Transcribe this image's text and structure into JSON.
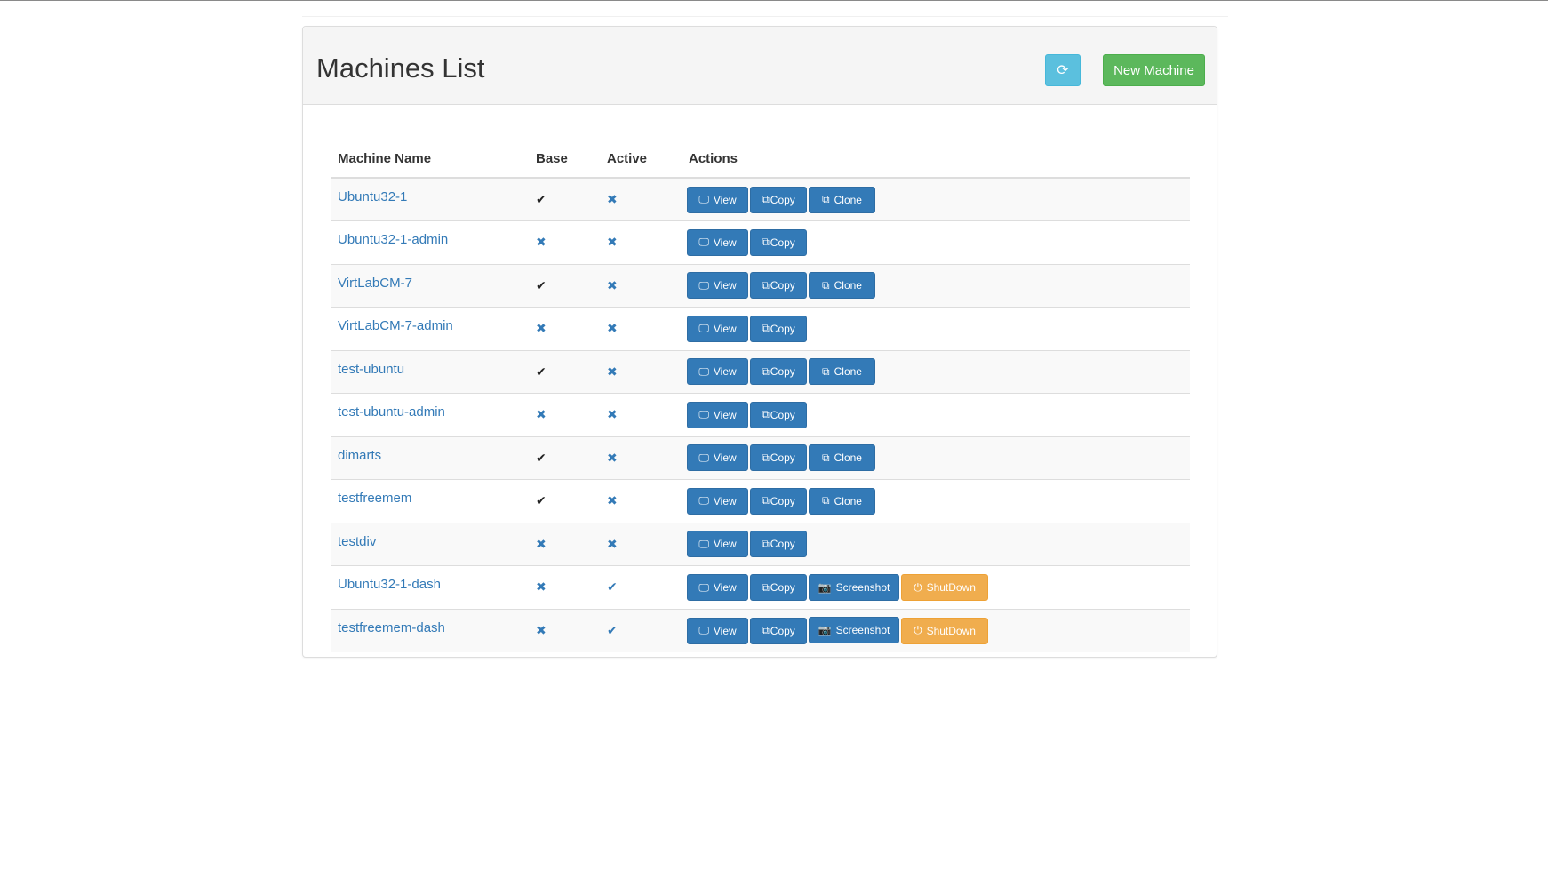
{
  "header": {
    "title": "Machines List",
    "refresh_icon": "refresh-icon",
    "new_machine_label": "New Machine"
  },
  "table": {
    "columns": [
      "Machine Name",
      "Base",
      "Active",
      "Actions"
    ],
    "action_labels": {
      "view": "View",
      "copy": "Copy",
      "clone": "Clone",
      "screenshot": "Screenshot",
      "shutdown": "ShutDown"
    },
    "rows": [
      {
        "name": "Ubuntu32-1",
        "base": true,
        "active": false,
        "actions": [
          "view",
          "copy",
          "clone"
        ]
      },
      {
        "name": "Ubuntu32-1-admin",
        "base": false,
        "active": false,
        "actions": [
          "view",
          "copy"
        ]
      },
      {
        "name": "VirtLabCM-7",
        "base": true,
        "active": false,
        "actions": [
          "view",
          "copy",
          "clone"
        ]
      },
      {
        "name": "VirtLabCM-7-admin",
        "base": false,
        "active": false,
        "actions": [
          "view",
          "copy"
        ]
      },
      {
        "name": "test-ubuntu",
        "base": true,
        "active": false,
        "actions": [
          "view",
          "copy",
          "clone"
        ]
      },
      {
        "name": "test-ubuntu-admin",
        "base": false,
        "active": false,
        "actions": [
          "view",
          "copy"
        ]
      },
      {
        "name": "dimarts",
        "base": true,
        "active": false,
        "actions": [
          "view",
          "copy",
          "clone"
        ]
      },
      {
        "name": "testfreemem",
        "base": true,
        "active": false,
        "actions": [
          "view",
          "copy",
          "clone"
        ]
      },
      {
        "name": "testdiv",
        "base": false,
        "active": false,
        "actions": [
          "view",
          "copy"
        ]
      },
      {
        "name": "Ubuntu32-1-dash",
        "base": false,
        "active": true,
        "actions": [
          "view",
          "copy",
          "screenshot",
          "shutdown"
        ]
      },
      {
        "name": "testfreemem-dash",
        "base": false,
        "active": true,
        "actions": [
          "view",
          "copy",
          "screenshot",
          "shutdown"
        ]
      }
    ]
  },
  "colors": {
    "primary": "#337ab7",
    "success": "#5cb85c",
    "info": "#5bc0de",
    "warning": "#f0ad4e"
  }
}
